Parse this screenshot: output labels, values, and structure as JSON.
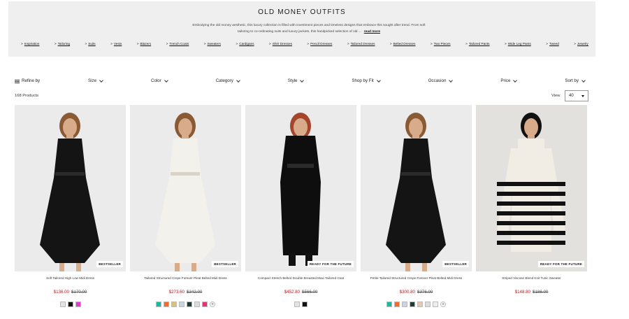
{
  "hero": {
    "title": "OLD MONEY OUTFITS",
    "description": "Embodying the old money aesthetic, this luxury collection is filled with investment pieces and timeless designs that embrace this sought after trend. From soft tailoring to co-ordinating suits and luxury jackets, this handpicked selection of old ...",
    "read_more": "read more",
    "categories": [
      "Inspiration",
      "Tailoring",
      "Suits",
      "Vests",
      "Blazers",
      "Trench Coats",
      "Sweaters",
      "Cardigans",
      "Shirt Dresses",
      "Pencil Dresses",
      "Tailored Dresses",
      "Belted Dresses",
      "Two Pieces",
      "Tailored Pants",
      "Wide Leg Pants",
      "Tweed",
      "Jewelry"
    ]
  },
  "filters": {
    "refine": "Refine by",
    "items": [
      "Size",
      "Color",
      "Category",
      "Style",
      "Shop by Fit",
      "Occasion",
      "Price",
      "Sort by"
    ]
  },
  "results": {
    "count": "168 Products",
    "view_label": "View",
    "per_page": "40"
  },
  "products": [
    {
      "name": "Soft Tailored High Low Midi Dress",
      "price": "$136.00",
      "was": "$170.00",
      "badge": "BESTSELLER",
      "garment": "#141414",
      "swatches": [
        "#e3e3e3",
        "#111111",
        "#e23ad0"
      ],
      "more": false
    },
    {
      "name": "Tailored Structured Crepe Forever Pleat Belted Midi Dress",
      "price": "$273.60",
      "was": "$342.00",
      "badge": "BESTSELLER",
      "garment": "#f3f1ec",
      "swatches": [
        "#1ab99e",
        "#f26b2c",
        "#d8c27a",
        "#c8d4e6",
        "#1f3b33",
        "#dcdcdc",
        "#e2337a"
      ],
      "more": true
    },
    {
      "name": "Compact Stretch Belted Double Breasted Maxi Tailored Coat",
      "price": "$452.80",
      "was": "$566.00",
      "badge": "READY FOR THE FUTURE",
      "garment": "#0e0e0e",
      "swatches": [
        "#e3e3e3",
        "#111111"
      ],
      "more": false
    },
    {
      "name": "Petite Tailored Structured Crepe Forever Pleat Belted Midi Dress",
      "price": "$300.80",
      "was": "$376.00",
      "badge": "BESTSELLER",
      "garment": "#141414",
      "swatches": [
        "#1ab99e",
        "#f26b2c",
        "#c8d4e6",
        "#1f3b33",
        "#e6c7b0",
        "#dcdcdc",
        "#eeeeee"
      ],
      "more": true
    },
    {
      "name": "Striped Viscose Blend Knit Tunic Sweater",
      "price": "$148.80",
      "was": "$186.00",
      "badge": "READY FOR THE FUTURE",
      "garment": "#f1ede4",
      "swatches": [],
      "more": false
    }
  ],
  "more_colors_symbol": "+"
}
